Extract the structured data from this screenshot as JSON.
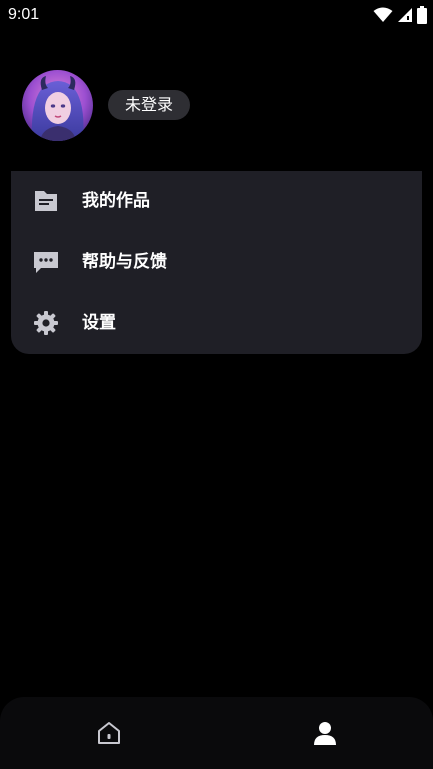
{
  "status_bar": {
    "time": "9:01",
    "icons": [
      "wifi-icon",
      "signal-icon",
      "battery-icon"
    ]
  },
  "profile": {
    "avatar": "avatar-image",
    "login_label": "未登录"
  },
  "menu": {
    "items": [
      {
        "icon": "folder-doc-icon",
        "label": "我的作品"
      },
      {
        "icon": "chat-bubble-icon",
        "label": "帮助与反馈"
      },
      {
        "icon": "gear-icon",
        "label": "设置"
      }
    ]
  },
  "bottom_nav": {
    "items": [
      {
        "icon": "home-icon",
        "active": false
      },
      {
        "icon": "person-icon",
        "active": true
      }
    ]
  },
  "colors": {
    "background": "#000000",
    "card": "#1f1f26",
    "pill": "#2e2e33",
    "icon": "#c8c8d0"
  }
}
